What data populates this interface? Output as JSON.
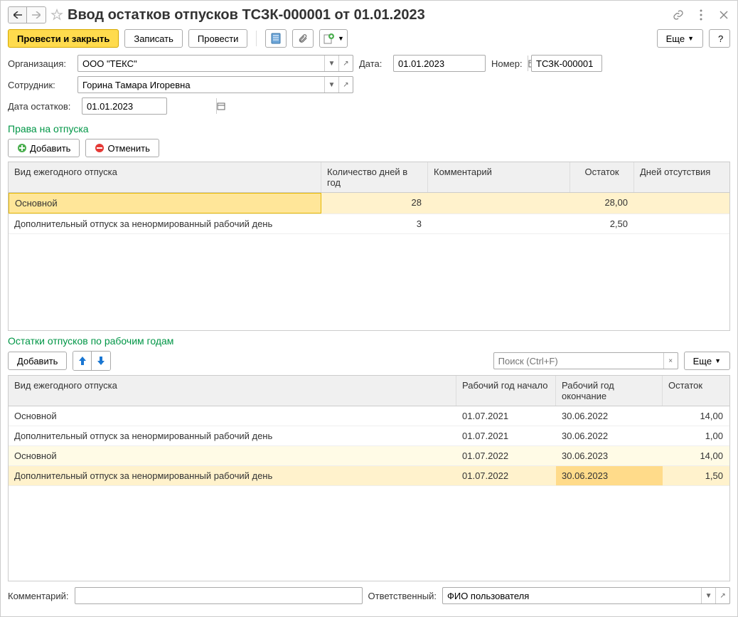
{
  "window": {
    "title": "Ввод остатков отпусков ТСЗК-000001 от 01.01.2023"
  },
  "toolbar": {
    "postClose": "Провести и закрыть",
    "write": "Записать",
    "post": "Провести",
    "more": "Еще",
    "help": "?"
  },
  "fields": {
    "orgLabel": "Организация:",
    "orgValue": "ООО \"ТЕКС\"",
    "dateLabel": "Дата:",
    "dateValue": "01.01.2023",
    "numberLabel": "Номер:",
    "numberValue": "ТСЗК-000001",
    "employeeLabel": "Сотрудник:",
    "employeeValue": "Горина Тамара Игоревна",
    "remDateLabel": "Дата остатков:",
    "remDateValue": "01.01.2023"
  },
  "section1": {
    "title": "Права на отпуска",
    "add": "Добавить",
    "cancel": "Отменить",
    "cols": [
      "Вид ежегодного отпуска",
      "Количество дней в год",
      "Комментарий",
      "Остаток",
      "Дней отсутствия"
    ],
    "rows": [
      {
        "type": "Основной",
        "days": "28",
        "comment": "",
        "remain": "28,00",
        "absent": ""
      },
      {
        "type": "Дополнительный отпуск за ненормированный рабочий день",
        "days": "3",
        "comment": "",
        "remain": "2,50",
        "absent": ""
      }
    ]
  },
  "section2": {
    "title": "Остатки отпусков по рабочим годам",
    "add": "Добавить",
    "searchPlaceholder": "Поиск (Ctrl+F)",
    "more": "Еще",
    "cols": [
      "Вид ежегодного отпуска",
      "Рабочий год начало",
      "Рабочий год окончание",
      "Остаток"
    ],
    "rows": [
      {
        "type": "Основной",
        "start": "01.07.2021",
        "end": "30.06.2022",
        "remain": "14,00"
      },
      {
        "type": "Дополнительный отпуск за ненормированный рабочий день",
        "start": "01.07.2021",
        "end": "30.06.2022",
        "remain": "1,00"
      },
      {
        "type": "Основной",
        "start": "01.07.2022",
        "end": "30.06.2023",
        "remain": "14,00"
      },
      {
        "type": "Дополнительный отпуск за ненормированный рабочий день",
        "start": "01.07.2022",
        "end": "30.06.2023",
        "remain": "1,50"
      }
    ]
  },
  "footer": {
    "commentLabel": "Комментарий:",
    "commentValue": "",
    "respLabel": "Ответственный:",
    "respValue": "ФИО пользователя"
  }
}
